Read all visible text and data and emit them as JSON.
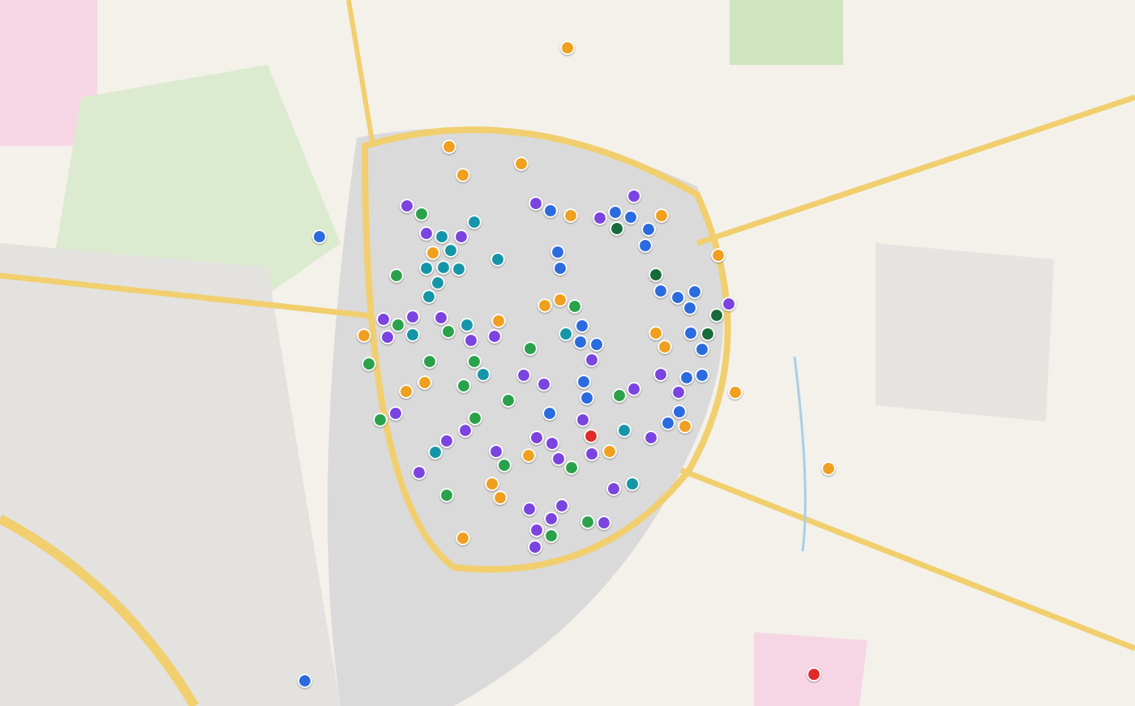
{
  "markers": [
    {
      "color": "#f0a01e"
    },
    {
      "color": "#f0a01e"
    },
    {
      "color": "#f0a01e"
    },
    {
      "color": "#f0a01e"
    },
    {
      "color": "#f0a01e"
    },
    {
      "color": "#f0a01e"
    },
    {
      "color": "#f0a01e"
    },
    {
      "color": "#f0a01e"
    },
    {
      "color": "#f0a01e"
    },
    {
      "color": "#f0a01e"
    },
    {
      "color": "#f0a01e"
    },
    {
      "color": "#f0a01e"
    },
    {
      "color": "#f0a01e"
    },
    {
      "color": "#f0a01e"
    },
    {
      "color": "#f0a01e"
    },
    {
      "color": "#f0a01e"
    },
    {
      "color": "#f0a01e"
    },
    {
      "color": "#f0a01e"
    },
    {
      "color": "#f0a01e"
    },
    {
      "color": "#f0a01e"
    },
    {
      "color": "#f0a01e"
    },
    {
      "color": "#f0a01e"
    },
    {
      "color": "#f0a01e"
    },
    {
      "color": "#f0a01e"
    },
    {
      "color": "#7b44e0"
    },
    {
      "color": "#7b44e0"
    },
    {
      "color": "#7b44e0"
    },
    {
      "color": "#7b44e0"
    },
    {
      "color": "#7b44e0"
    },
    {
      "color": "#7b44e0"
    },
    {
      "color": "#7b44e0"
    },
    {
      "color": "#7b44e0"
    },
    {
      "color": "#7b44e0"
    },
    {
      "color": "#7b44e0"
    },
    {
      "color": "#7b44e0"
    },
    {
      "color": "#7b44e0"
    },
    {
      "color": "#7b44e0"
    },
    {
      "color": "#7b44e0"
    },
    {
      "color": "#7b44e0"
    },
    {
      "color": "#7b44e0"
    },
    {
      "color": "#7b44e0"
    },
    {
      "color": "#7b44e0"
    },
    {
      "color": "#7b44e0"
    },
    {
      "color": "#7b44e0"
    },
    {
      "color": "#7b44e0"
    },
    {
      "color": "#7b44e0"
    },
    {
      "color": "#7b44e0"
    },
    {
      "color": "#7b44e0"
    },
    {
      "color": "#7b44e0"
    },
    {
      "color": "#7b44e0"
    },
    {
      "color": "#7b44e0"
    },
    {
      "color": "#7b44e0"
    },
    {
      "color": "#7b44e0"
    },
    {
      "color": "#7b44e0"
    },
    {
      "color": "#7b44e0"
    },
    {
      "color": "#7b44e0"
    },
    {
      "color": "#7b44e0"
    },
    {
      "color": "#7b44e0"
    },
    {
      "color": "#7b44e0"
    },
    {
      "color": "#7b44e0"
    },
    {
      "color": "#7b44e0"
    },
    {
      "color": "#2b6be0"
    },
    {
      "color": "#2b6be0"
    },
    {
      "color": "#2b6be0"
    },
    {
      "color": "#2b6be0"
    },
    {
      "color": "#2b6be0"
    },
    {
      "color": "#2b6be0"
    },
    {
      "color": "#2b6be0"
    },
    {
      "color": "#2b6be0"
    },
    {
      "color": "#2b6be0"
    },
    {
      "color": "#2b6be0"
    },
    {
      "color": "#2b6be0"
    },
    {
      "color": "#2b6be0"
    },
    {
      "color": "#2b6be0"
    },
    {
      "color": "#2b6be0"
    },
    {
      "color": "#2b6be0"
    },
    {
      "color": "#2b6be0"
    },
    {
      "color": "#2b6be0"
    },
    {
      "color": "#2b6be0"
    },
    {
      "color": "#2b6be0"
    },
    {
      "color": "#2b6be0"
    },
    {
      "color": "#2b6be0"
    },
    {
      "color": "#2b6be0"
    },
    {
      "color": "#2b6be0"
    },
    {
      "color": "#2b6be0"
    },
    {
      "color": "#2b6be0"
    },
    {
      "color": "#1596a8"
    },
    {
      "color": "#1596a8"
    },
    {
      "color": "#1596a8"
    },
    {
      "color": "#1596a8"
    },
    {
      "color": "#1596a8"
    },
    {
      "color": "#1596a8"
    },
    {
      "color": "#1596a8"
    },
    {
      "color": "#1596a8"
    },
    {
      "color": "#1596a8"
    },
    {
      "color": "#1596a8"
    },
    {
      "color": "#1596a8"
    },
    {
      "color": "#1596a8"
    },
    {
      "color": "#1596a8"
    },
    {
      "color": "#1596a8"
    },
    {
      "color": "#1596a8"
    },
    {
      "color": "#1596a8"
    },
    {
      "color": "#2aa24a"
    },
    {
      "color": "#2aa24a"
    },
    {
      "color": "#2aa24a"
    },
    {
      "color": "#2aa24a"
    },
    {
      "color": "#2aa24a"
    },
    {
      "color": "#2aa24a"
    },
    {
      "color": "#2aa24a"
    },
    {
      "color": "#2aa24a"
    },
    {
      "color": "#2aa24a"
    },
    {
      "color": "#2aa24a"
    },
    {
      "color": "#2aa24a"
    },
    {
      "color": "#2aa24a"
    },
    {
      "color": "#2aa24a"
    },
    {
      "color": "#2aa24a"
    },
    {
      "color": "#2aa24a"
    },
    {
      "color": "#2aa24a"
    },
    {
      "color": "#2aa24a"
    },
    {
      "color": "#2aa24a"
    },
    {
      "color": "#2aa24a"
    },
    {
      "color": "#176b3a"
    },
    {
      "color": "#176b3a"
    },
    {
      "color": "#176b3a"
    },
    {
      "color": "#176b3a"
    },
    {
      "color": "#e02a2a"
    },
    {
      "color": "#e02a2a"
    }
  ]
}
